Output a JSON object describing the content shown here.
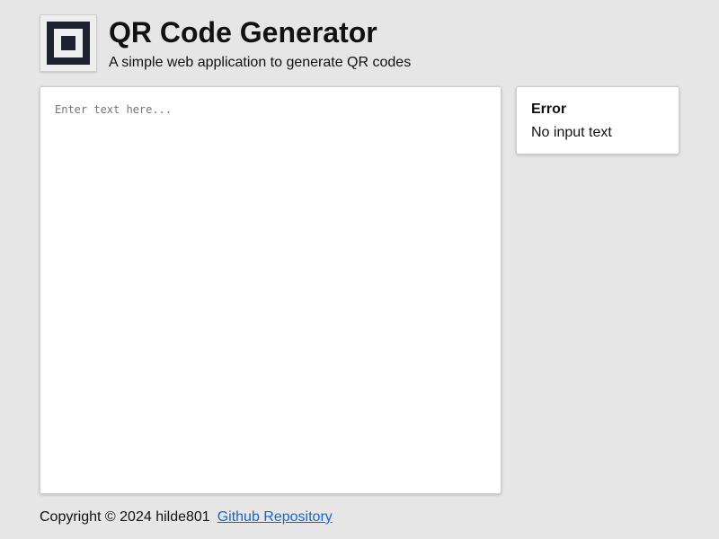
{
  "header": {
    "title": "QR Code Generator",
    "subtitle": "A simple web application to generate QR codes",
    "logo_icon": "qr-finder-square-icon"
  },
  "editor": {
    "value": "",
    "placeholder": "Enter text here..."
  },
  "error": {
    "title": "Error",
    "message": "No input text"
  },
  "footer": {
    "copyright": "Copyright © 2024 hilde801",
    "link_label": "Github Repository"
  },
  "colors": {
    "background": "#e6e6e6",
    "panel": "#ffffff",
    "logo_dark": "#1f2130",
    "link": "#1a66c7"
  }
}
